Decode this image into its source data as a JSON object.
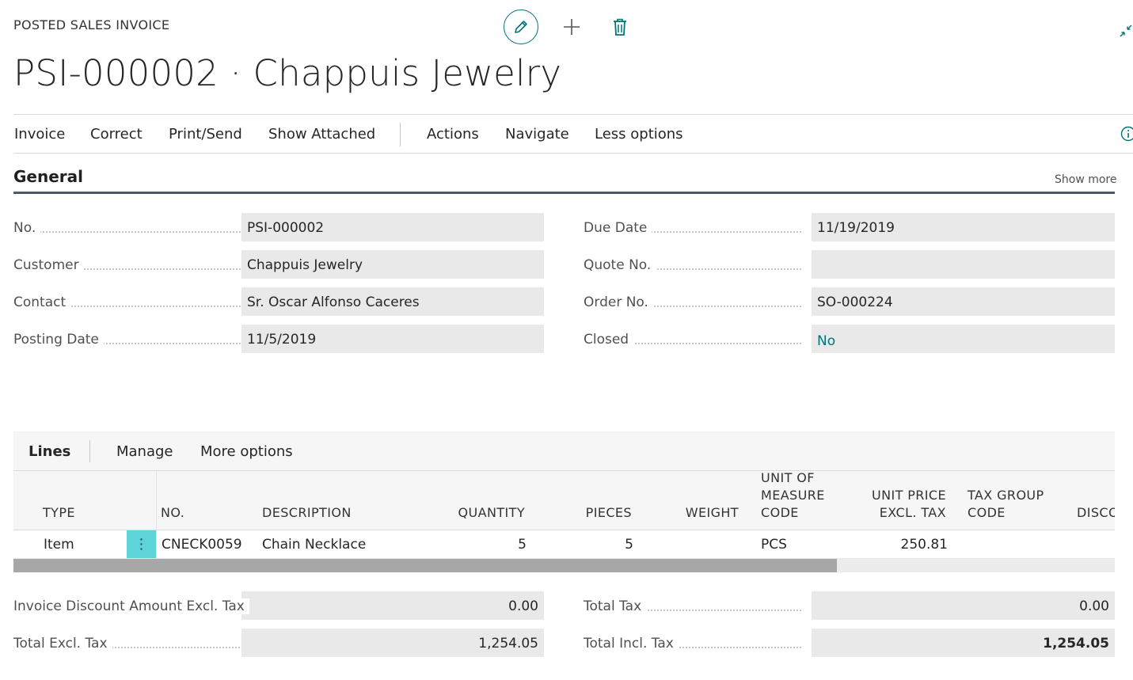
{
  "header": {
    "page_kind": "POSTED SALES INVOICE",
    "title": "PSI-000002 · Chappuis Jewelry"
  },
  "top_actions": {
    "edit_icon": "pencil-icon",
    "new_icon": "plus-icon",
    "delete_icon": "trash-icon",
    "collapse_icon": "collapse-arrows-icon"
  },
  "action_bar": {
    "items": [
      "Invoice",
      "Correct",
      "Print/Send",
      "Show Attached",
      "Actions",
      "Navigate",
      "Less options"
    ],
    "info_icon": "info-icon"
  },
  "general": {
    "title": "General",
    "show_more": "Show more",
    "left_fields": [
      {
        "label": "No.",
        "value": "PSI-000002"
      },
      {
        "label": "Customer",
        "value": "Chappuis Jewelry"
      },
      {
        "label": "Contact",
        "value": "Sr. Oscar Alfonso Caceres"
      },
      {
        "label": "Posting Date",
        "value": "11/5/2019"
      }
    ],
    "right_fields": [
      {
        "label": "Due Date",
        "value": "11/19/2019"
      },
      {
        "label": "Quote No.",
        "value": ""
      },
      {
        "label": "Order No.",
        "value": "SO-000224"
      },
      {
        "label": "Closed",
        "value": "No"
      }
    ]
  },
  "lines": {
    "tabs": [
      "Lines",
      "Manage",
      "More options"
    ],
    "columns": [
      "TYPE",
      "NO.",
      "DESCRIPTION",
      "QUANTITY",
      "PIECES",
      "WEIGHT",
      "UNIT OF",
      "MEASURE",
      "CODE",
      "UNIT PRICE",
      "EXCL. TAX",
      "TAX GROUP",
      "CODE",
      "DISCO"
    ],
    "rows": [
      {
        "type": "Item",
        "no": "CNECK0059",
        "description": "Chain Necklace",
        "quantity": "5",
        "pieces": "5",
        "weight": "",
        "uom": "PCS",
        "unit_price": "250.81",
        "tax_group": ""
      }
    ],
    "row_menu_icon": "vertical-ellipsis-icon"
  },
  "totals": {
    "invoice_discount_label": "Invoice Discount Amount Excl. Tax",
    "invoice_discount_value": "0.00",
    "total_excl_label": "Total Excl. Tax",
    "total_excl_value": "1,254.05",
    "total_tax_label": "Total Tax",
    "total_tax_value": "0.00",
    "total_incl_label": "Total Incl. Tax",
    "total_incl_value": "1,254.05"
  },
  "colors": {
    "accent": "#00737a",
    "row_menu": "#5fd4d8",
    "section_rule": "#4e5868"
  }
}
